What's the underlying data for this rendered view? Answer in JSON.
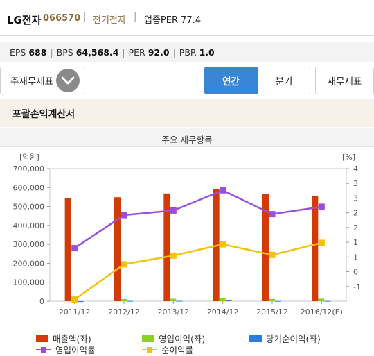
{
  "header": {
    "name": "LG전자",
    "code": "066570",
    "separator": "|",
    "sector": "전기전자",
    "industry_per": "업종PER 77.4"
  },
  "metrics": [
    {
      "label": "EPS",
      "value": "688"
    },
    {
      "label": "BPS",
      "value": "64,568.4"
    },
    {
      "label": "PER",
      "value": "92.0"
    },
    {
      "label": "PBR",
      "value": "1.0"
    }
  ],
  "buttons": {
    "main_fs": "주재무제표",
    "annual": "연간",
    "quarter": "분기",
    "fs": "재무제표"
  },
  "section_title": "포괄손익계산서",
  "sub_title": "주요 재무항목",
  "colors": {
    "sales": "#d33a06",
    "op_income": "#8ccf2a",
    "net_income": "#2e7be0",
    "op_margin": "#9b4fd8",
    "net_margin": "#f4c20d"
  },
  "chart_data": {
    "type": "bar",
    "left_unit": "[억원]",
    "right_unit": "[%]",
    "categories": [
      "2011/12",
      "2012/12",
      "2013/12",
      "2014/12",
      "2015/12",
      "2016/12(E)"
    ],
    "ylim_left": [
      0,
      700000
    ],
    "y_ticks_left": [
      "0",
      "100,000",
      "200,000",
      "300,000",
      "400,000",
      "500,000",
      "600,000",
      "700,000"
    ],
    "ylim_right": [
      -1.5,
      4
    ],
    "y_ticks_right": [
      "-1",
      "0",
      "1",
      "1",
      "2",
      "2",
      "3",
      "3",
      "4"
    ],
    "series": [
      {
        "name": "매출액(좌)",
        "axis": "left",
        "type": "bar",
        "values": [
          542567,
          548854,
          568768,
          590408,
          565090,
          553670
        ]
      },
      {
        "name": "영업이익(좌)",
        "axis": "left",
        "type": "bar",
        "values": [
          3792,
          11360,
          12847,
          18286,
          11923,
          13378
        ]
      },
      {
        "name": "당기순이익(좌)",
        "axis": "left",
        "type": "bar",
        "values": [
          -4160,
          1235,
          1768,
          3994,
          1244,
          1260
        ]
      },
      {
        "name": "영업이익률",
        "axis": "right",
        "type": "line",
        "values": [
          0.7,
          2.07,
          2.26,
          3.1,
          2.11,
          2.42
        ]
      },
      {
        "name": "순이익률",
        "axis": "right",
        "type": "line",
        "values": [
          -1.43,
          0.03,
          0.39,
          0.86,
          0.42,
          0.92
        ]
      }
    ]
  },
  "legend": [
    "매출액(좌)",
    "영업이익(좌)",
    "당기순이익(좌)",
    "영업이익률",
    "순이익률"
  ]
}
